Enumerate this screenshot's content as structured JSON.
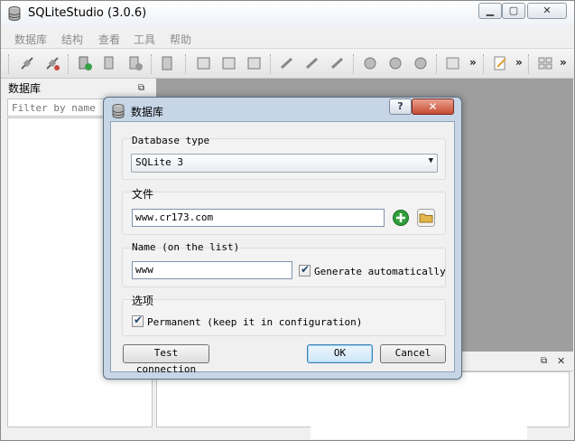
{
  "window": {
    "title": "SQLiteStudio (3.0.6)",
    "controls": {
      "minimize": "▁",
      "maximize": "▢",
      "close": "✕"
    }
  },
  "menu": [
    "数据库",
    "结构",
    "查看",
    "工具",
    "帮助"
  ],
  "toolbar": {
    "overflow": "»"
  },
  "db_dock": {
    "title": "数据库",
    "filter_placeholder": "Filter by name"
  },
  "dialog": {
    "title": "数据库",
    "help": "?",
    "close": "✕",
    "database_type": {
      "label": "Database type",
      "selected": "SQLite 3"
    },
    "file": {
      "label": "文件",
      "value": "www.cr173.com"
    },
    "name": {
      "label": "Name (on the list)",
      "value": "www",
      "auto_label": "Generate automatically",
      "auto_checked": true
    },
    "options": {
      "label": "选项",
      "permanent_label": "Permanent (keep it in configuration)",
      "permanent_checked": true
    },
    "buttons": {
      "test": "Test connection",
      "ok": "OK",
      "cancel": "Cancel"
    }
  },
  "colors": {
    "dialog_frame": "#c6d6e7",
    "mdi_background": "#9e9e9e",
    "close_button": "#c74b32",
    "add_icon": "#2f9e3a",
    "folder_icon": "#e2b64a"
  }
}
